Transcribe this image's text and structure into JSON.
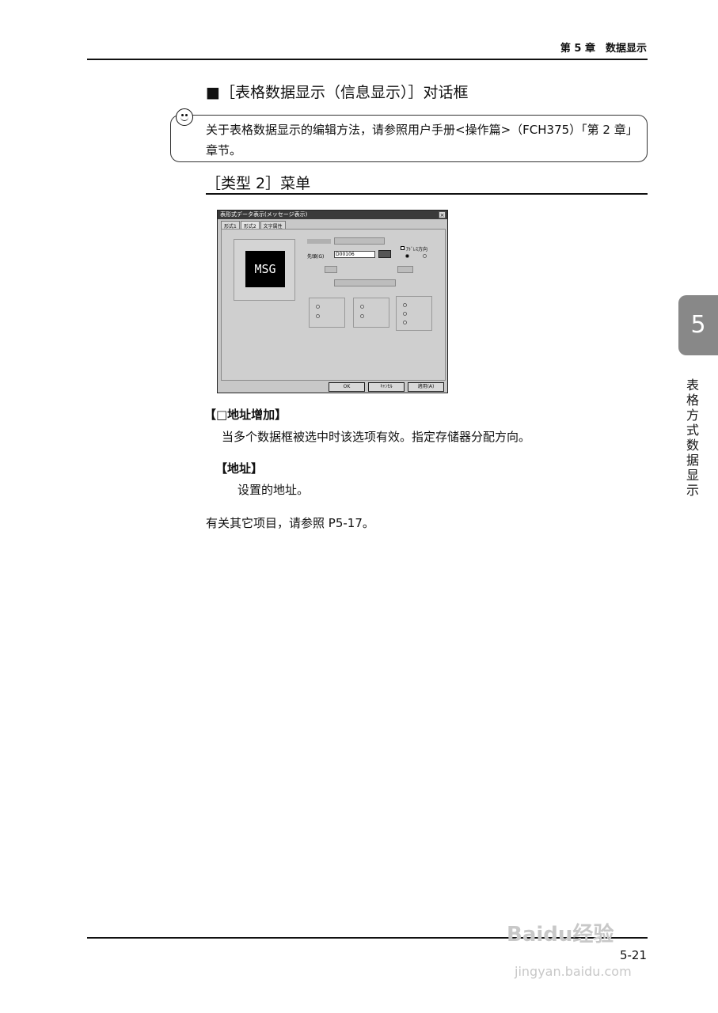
{
  "header": {
    "chapter": "第 5 章　数据显示"
  },
  "section": {
    "title": "■［表格数据显示（信息显示）］对话框"
  },
  "note": {
    "icon": "smiley-icon",
    "text": "关于表格数据显示的编辑方法，请参照用户手册<操作篇>（FCH375）「第 2 章」章节。"
  },
  "subsection": {
    "title": "［类型 2］菜单"
  },
  "dialog": {
    "title": "表形式データ表示(メッセージ表示)",
    "close": "×",
    "tabs": [
      "形式1",
      "形式2",
      "文字属性"
    ],
    "preview_text": "MSG",
    "address_label": "先頭(G)",
    "address_value": "D00106",
    "checkbox_label": "ｱﾄﾞﾚｽ方向",
    "ok": "OK",
    "cancel": "ｷｬﾝｾﾙ",
    "apply": "適用(A)"
  },
  "items": [
    {
      "title": "【□地址增加】",
      "desc": "当多个数据框被选中时该选项有效。指定存储器分配方向。"
    },
    {
      "title": "【地址】",
      "desc": "设置的地址。"
    }
  ],
  "other": "有关其它项目，请参照 P5-17。",
  "side": {
    "number": "5",
    "label": "表格方式数据显示"
  },
  "footer": {
    "page": "5-21"
  },
  "watermark": {
    "brand": "Baidu经验",
    "url": "jingyan.baidu.com"
  }
}
